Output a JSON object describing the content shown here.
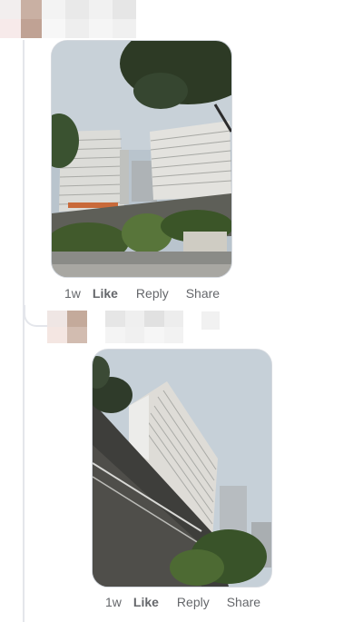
{
  "comment": {
    "photo_alt": "Tall residential buildings and trees under cloudy sky",
    "actions": {
      "time": "1w",
      "like": "Like",
      "reply": "Reply",
      "share": "Share"
    }
  },
  "reply": {
    "photo_alt": "High-rise apartment block behind a stone retaining wall",
    "actions": {
      "time": "1w",
      "like": "Like",
      "reply": "Reply",
      "share": "Share"
    }
  },
  "colors": {
    "thread_line": "#e4e6eb",
    "action_text": "#65676b",
    "pixelated_top": [
      "#f2eeee",
      "#c9b0a3",
      "#f7eaea",
      "#c0a294"
    ],
    "pixelated_name": [
      "#f3f3f3",
      "#e6e6e6",
      "#ededed",
      "#f7f7f7"
    ]
  }
}
